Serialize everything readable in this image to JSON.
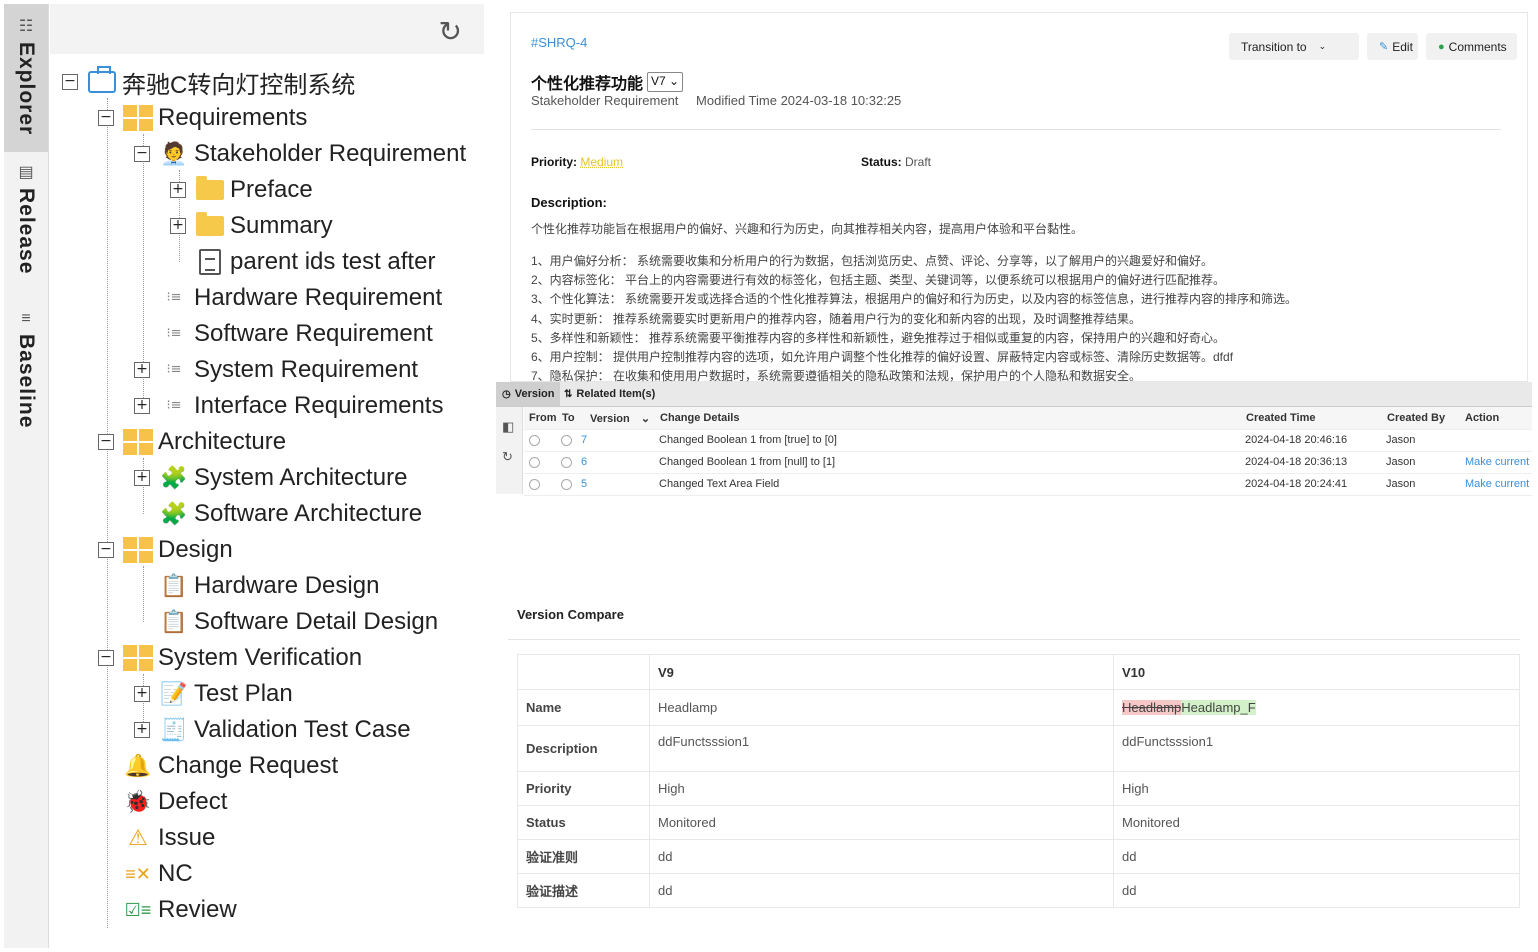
{
  "rail": {
    "tabs": [
      {
        "label": "Explorer",
        "icon": "tree-icon"
      },
      {
        "label": "Release",
        "icon": "clipboard-icon"
      },
      {
        "label": "Baseline",
        "icon": "list-icon"
      }
    ]
  },
  "tree": {
    "root": "奔驰C转向灯控制系统",
    "requirements": "Requirements",
    "stakeholder": "Stakeholder Requirement",
    "preface": "Preface",
    "summary": "Summary",
    "parent_ids": "parent ids test after",
    "hardware_req": "Hardware Requirement",
    "software_req": "Software Requirement",
    "system_req": "System Requirement",
    "interface_req": "Interface Requirements",
    "architecture": "Architecture",
    "system_arch": "System Architecture",
    "software_arch": "Software Architecture",
    "design": "Design",
    "hardware_design": "Hardware Design",
    "software_detail_design": "Software Detail Design",
    "system_verification": "System Verification",
    "test_plan": "Test Plan",
    "validation_test_case": "Validation Test Case",
    "change_request": "Change Request",
    "defect": "Defect",
    "issue": "Issue",
    "nc": "NC",
    "review": "Review"
  },
  "detail": {
    "id": "#SHRQ-4",
    "transition_label": "Transition to",
    "edit_label": "Edit",
    "comments_label": "Comments",
    "title": "个性化推荐功能",
    "version": "V7",
    "type": "Stakeholder Requirement",
    "modified": "Modified Time 2024-03-18 10:32:25",
    "priority_label": "Priority:",
    "priority_value": "Medium",
    "status_label": "Status:",
    "status_value": "Draft",
    "description_label": "Description:",
    "description_intro": "个性化推荐功能旨在根据用户的偏好、兴趣和行为历史，向其推荐相关内容，提高用户体验和平台黏性。",
    "description_lines": [
      "1、用户偏好分析： 系统需要收集和分析用户的行为数据，包括浏览历史、点赞、评论、分享等，以了解用户的兴趣爱好和偏好。",
      "2、内容标签化： 平台上的内容需要进行有效的标签化，包括主题、类型、关键词等，以便系统可以根据用户的偏好进行匹配推荐。",
      "3、个性化算法： 系统需要开发或选择合适的个性化推荐算法，根据用户的偏好和行为历史，以及内容的标签信息，进行推荐内容的排序和筛选。",
      "4、实时更新： 推荐系统需要实时更新用户的推荐内容，随着用户行为的变化和新内容的出现，及时调整推荐结果。",
      "5、多样性和新颖性： 推荐系统需要平衡推荐内容的多样性和新颖性，避免推荐过于相似或重复的内容，保持用户的兴趣和好奇心。",
      "6、用户控制： 提供用户控制推荐内容的选项，如允许用户调整个性化推荐的偏好设置、屏蔽特定内容或标签、清除历史数据等。dfdf",
      "7、隐私保护： 在收集和使用用户数据时，系统需要遵循相关的隐私政策和法规，保护用户的个人隐私和数据安全。"
    ]
  },
  "history": {
    "tab_version": "Version",
    "tab_related": "Related Item(s)",
    "columns": [
      "From",
      "To",
      "Version",
      "Change Details",
      "Created Time",
      "Created By",
      "Action"
    ],
    "rows": [
      {
        "version": "7",
        "details": "Changed Boolean 1 from [true] to [0]",
        "created": "2024-04-18 20:46:16",
        "by": "Jason",
        "action": ""
      },
      {
        "version": "6",
        "details": "Changed Boolean 1 from [null] to [1]",
        "created": "2024-04-18 20:36:13",
        "by": "Jason",
        "action": "Make current"
      },
      {
        "version": "5",
        "details": "Changed Text Area Field",
        "created": "2024-04-18 20:24:41",
        "by": "Jason",
        "action": "Make current"
      }
    ]
  },
  "compare": {
    "title": "Version Compare",
    "left_version": "V9",
    "right_version": "V10",
    "rows": [
      {
        "field": "Name",
        "left": "Headlamp",
        "right_deleted": "Headlamp",
        "right_inserted": "Headlamp_F"
      },
      {
        "field": "Description",
        "left": "ddFunctsssion1",
        "right": "ddFunctsssion1"
      },
      {
        "field": "Priority",
        "left": "High",
        "right": "High"
      },
      {
        "field": "Status",
        "left": "Monitored",
        "right": "Monitored"
      },
      {
        "field": "验证准则",
        "left": "dd",
        "right": "dd"
      },
      {
        "field": "验证描述",
        "left": "dd",
        "right": "dd"
      }
    ]
  },
  "colors": {
    "accent": "#3a8fd8",
    "priority_medium": "#e8c32a",
    "diff_delete": "#f6c7c7",
    "diff_insert": "#d3f2c9",
    "folder": "#f6c94a"
  }
}
